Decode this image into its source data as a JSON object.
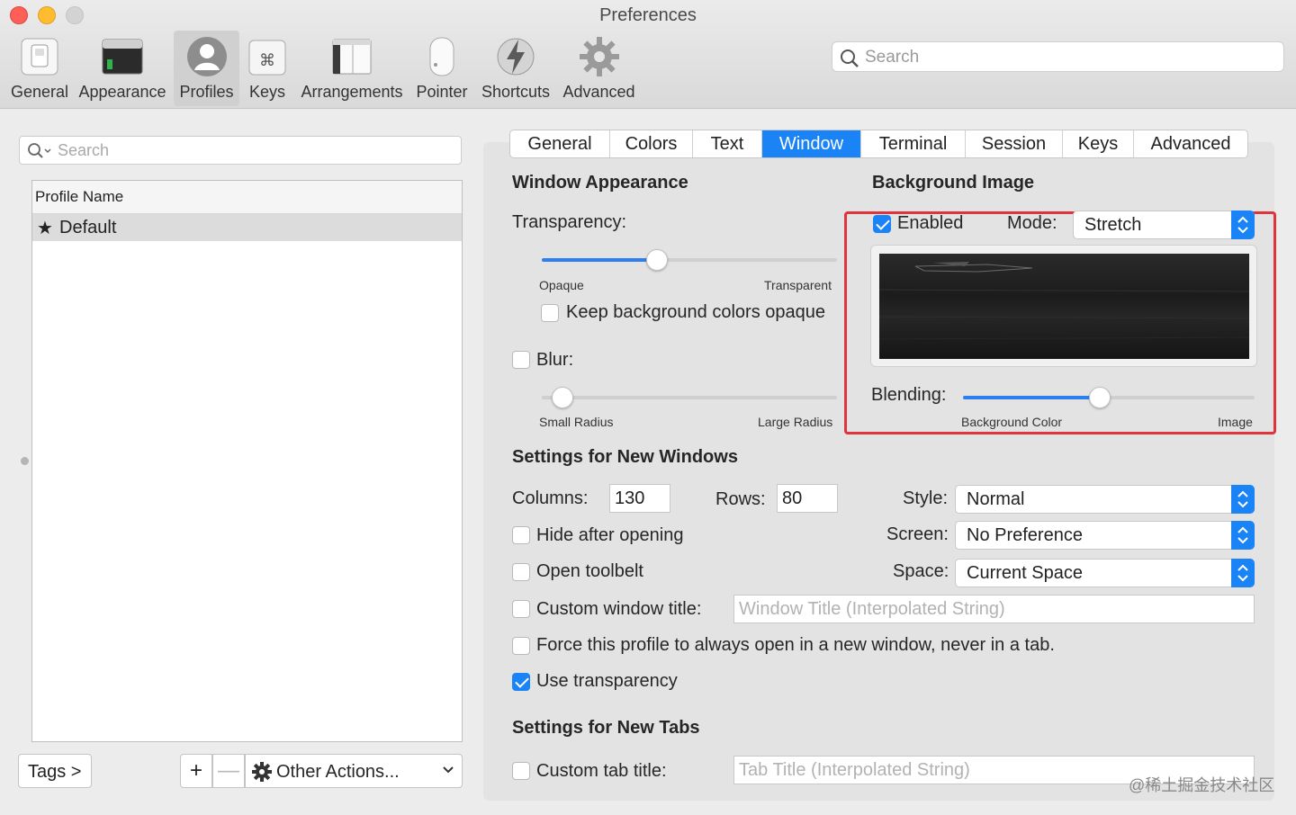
{
  "window": {
    "title": "Preferences"
  },
  "toolbar": {
    "items": [
      {
        "label": "General",
        "icon": "general-switch-icon"
      },
      {
        "label": "Appearance",
        "icon": "appearance-window-icon"
      },
      {
        "label": "Profiles",
        "icon": "profiles-person-icon",
        "selected": true
      },
      {
        "label": "Keys",
        "icon": "keys-command-icon"
      },
      {
        "label": "Arrangements",
        "icon": "arrangements-windows-icon"
      },
      {
        "label": "Pointer",
        "icon": "pointer-mouse-icon"
      },
      {
        "label": "Shortcuts",
        "icon": "shortcuts-bolt-icon"
      },
      {
        "label": "Advanced",
        "icon": "advanced-gear-icon"
      }
    ],
    "search_placeholder": "Search"
  },
  "profiles": {
    "search_placeholder": "Search",
    "column_header": "Profile Name",
    "rows": [
      {
        "name": "Default",
        "is_default": true
      }
    ],
    "tags_button": "Tags >",
    "add_button": "+",
    "remove_button": "—",
    "other_actions_button": "Other Actions..."
  },
  "tabs": {
    "items": [
      "General",
      "Colors",
      "Text",
      "Window",
      "Terminal",
      "Session",
      "Keys",
      "Advanced"
    ],
    "active": "Window"
  },
  "window_appearance": {
    "title": "Window Appearance",
    "transparency_label": "Transparency:",
    "transparency_value": 0.39,
    "transparency_min_label": "Opaque",
    "transparency_max_label": "Transparent",
    "keep_bg_opaque_label": "Keep background colors opaque",
    "keep_bg_opaque_checked": false,
    "blur_label": "Blur:",
    "blur_checked": false,
    "blur_value": 0.07,
    "blur_min_label": "Small Radius",
    "blur_max_label": "Large Radius"
  },
  "background_image": {
    "title": "Background Image",
    "enabled_label": "Enabled",
    "enabled_checked": true,
    "mode_label": "Mode:",
    "mode_value": "Stretch",
    "blending_label": "Blending:",
    "blending_value": 0.47,
    "blending_min_label": "Background Color",
    "blending_max_label": "Image"
  },
  "new_windows": {
    "title": "Settings for New Windows",
    "columns_label": "Columns:",
    "columns_value": "130",
    "rows_label": "Rows:",
    "rows_value": "80",
    "style_label": "Style:",
    "style_value": "Normal",
    "screen_label": "Screen:",
    "screen_value": "No Preference",
    "space_label": "Space:",
    "space_value": "Current Space",
    "hide_after_opening_label": "Hide after opening",
    "hide_after_opening_checked": false,
    "open_toolbelt_label": "Open toolbelt",
    "open_toolbelt_checked": false,
    "custom_window_title_label": "Custom window title:",
    "custom_window_title_checked": false,
    "window_title_placeholder": "Window Title (Interpolated String)",
    "force_new_window_label": "Force this profile to always open in a new window, never in a tab.",
    "force_new_window_checked": false,
    "use_transparency_label": "Use transparency",
    "use_transparency_checked": true
  },
  "new_tabs": {
    "title": "Settings for New Tabs",
    "custom_tab_title_label": "Custom tab title:",
    "custom_tab_title_checked": false,
    "tab_title_placeholder": "Tab Title (Interpolated String)"
  },
  "colors": {
    "accent": "#1a84f6",
    "highlight_box": "#e0333c"
  },
  "watermark": "@稀土掘金技术社区"
}
